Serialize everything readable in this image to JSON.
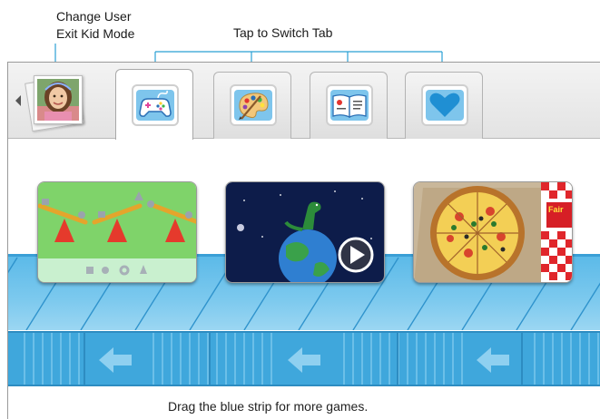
{
  "callouts": {
    "user_line1": "Change User",
    "user_line2": "Exit Kid Mode",
    "tabs": "Tap to Switch Tab"
  },
  "user": {
    "avatar": "child-photo"
  },
  "tabs": [
    {
      "icon": "game-controller-icon",
      "active": true
    },
    {
      "icon": "art-palette-icon",
      "active": false
    },
    {
      "icon": "book-icon",
      "active": false
    },
    {
      "icon": "heart-icon",
      "active": false
    }
  ],
  "cards": [
    {
      "art": "seesaw-balance-game",
      "shapes": [
        "cube",
        "sphere",
        "ring",
        "cone"
      ]
    },
    {
      "art": "dinosaur-on-earth-video",
      "overlay": "play-icon"
    },
    {
      "art": "pizza-game",
      "sign_text": "Fair"
    }
  ],
  "strip": {
    "arrows": "left-arrow-icon",
    "colors": {
      "top": "#5ab9e8",
      "bottom": "#3fa7dc",
      "arrow": "#7fc6ec"
    }
  },
  "hint": "Drag the blue strip for more games."
}
